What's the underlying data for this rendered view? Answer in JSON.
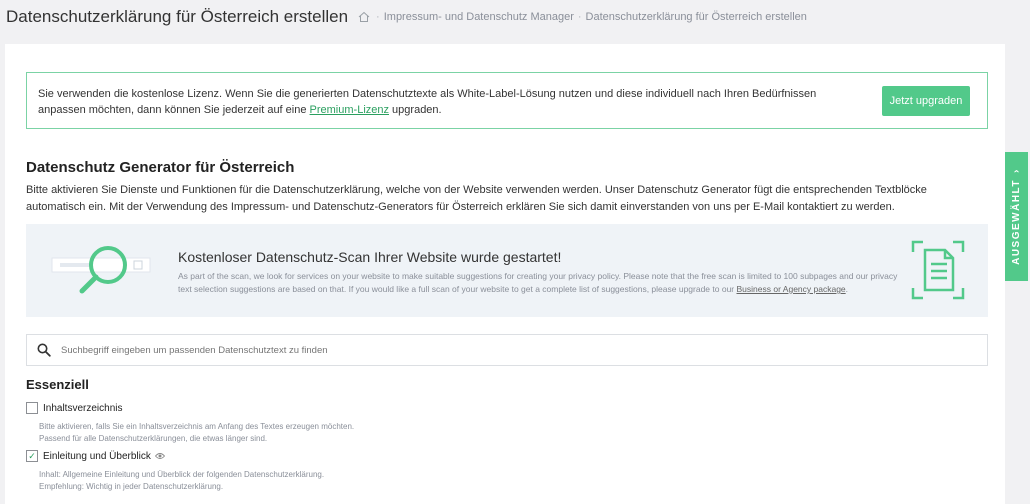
{
  "header": {
    "title": "Datenschutzerklärung für Österreich erstellen",
    "breadcrumb": [
      "Impressum- und Datenschutz Manager",
      "Datenschutzerklärung für Österreich erstellen"
    ]
  },
  "notice": {
    "text_before": "Sie verwenden die kostenlose Lizenz. Wenn Sie die generierten Datenschutztexte als White-Label-Lösung nutzen und diese individuell nach Ihren Bedürfnissen anpassen möchten, dann können Sie jederzeit auf eine ",
    "link": "Premium-Lizenz",
    "text_after": " upgraden.",
    "button": "Jetzt upgraden"
  },
  "section": {
    "title": "Datenschutz Generator für Österreich",
    "description": "Bitte aktivieren Sie Dienste und Funktionen für die Datenschutzerklärung, welche von der Website verwenden werden. Unser Datenschutz Generator fügt die entsprechenden Textblöcke automatisch ein. Mit der Verwendung des Impressum- und Datenschutz-Generators für Österreich erklären Sie sich damit einverstanden von uns per E-Mail kontaktiert zu werden."
  },
  "scan": {
    "title": "Kostenloser Datenschutz-Scan Ihrer Website wurde gestartet!",
    "text_before": "As part of the scan, we look for services on your website to make suitable suggestions for creating your privacy policy. Please note that the free scan is limited to 100 subpages and our privacy text selection suggestions are based on that. If you would like a full scan of your website to get a complete list of suggestions, please upgrade to our ",
    "link": "Business or Agency package",
    "text_after": "."
  },
  "search": {
    "placeholder": "Suchbegriff eingeben um passenden Datenschutztext zu finden"
  },
  "group": {
    "title": "Essenziell",
    "options": [
      {
        "label": "Inhaltsverzeichnis",
        "checked": false,
        "desc_line1": "Bitte aktivieren, falls Sie ein Inhaltsverzeichnis am Anfang des Textes erzeugen möchten.",
        "desc_line2": "Passend für alle Datenschutzerklärungen, die etwas länger sind."
      },
      {
        "label": "Einleitung und Überblick",
        "checked": true,
        "desc_line1": "Inhalt: Allgemeine Einleitung und Überblick der folgenden Datenschutzerklärung.",
        "desc_line2": "Empfehlung: Wichtig in jeder Datenschutzerklärung."
      }
    ]
  },
  "side_tab": {
    "label": "AUSGEWÄHLT"
  },
  "colors": {
    "accent": "#52c98a",
    "link": "#2a9f5f",
    "banner_bg": "#eff3f7"
  }
}
